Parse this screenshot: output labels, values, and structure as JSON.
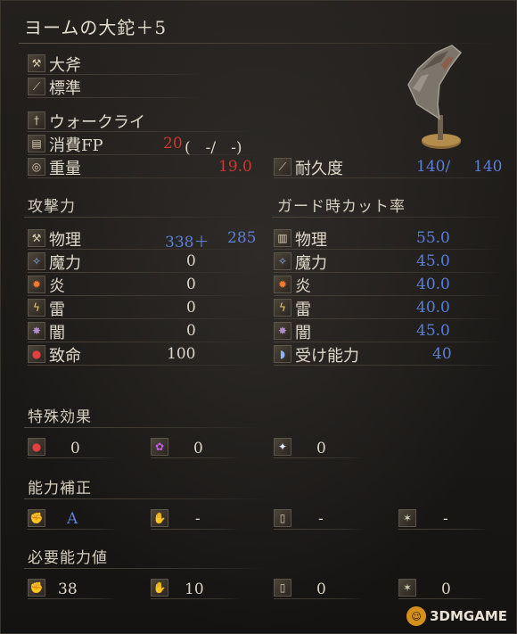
{
  "title": "ヨームの大鉈＋5",
  "weapon": {
    "type": "大斧",
    "attack_type": "標準",
    "skill": "ウォークライ",
    "fp_label": "消費FP",
    "fp_value": "20",
    "fp_extra": "(　-/　-)",
    "weight_label": "重量",
    "weight_value": "19.0",
    "durability_label": "耐久度",
    "durability_current": "140/",
    "durability_max": "140"
  },
  "attack": {
    "heading": "攻撃力",
    "rows": [
      {
        "label": "物理",
        "value": "338＋",
        "value2": "285",
        "icon": "physical-icon"
      },
      {
        "label": "魔力",
        "value": "0",
        "icon": "magic-icon"
      },
      {
        "label": "炎",
        "value": "0",
        "icon": "fire-icon"
      },
      {
        "label": "雷",
        "value": "0",
        "icon": "lightning-icon"
      },
      {
        "label": "闇",
        "value": "0",
        "icon": "dark-icon"
      },
      {
        "label": "致命",
        "value": "100",
        "icon": "critical-icon"
      }
    ]
  },
  "guard": {
    "heading": "ガード時カット率",
    "rows": [
      {
        "label": "物理",
        "value": "55.0",
        "icon": "physical-guard-icon"
      },
      {
        "label": "魔力",
        "value": "45.0",
        "icon": "magic-guard-icon"
      },
      {
        "label": "炎",
        "value": "40.0",
        "icon": "fire-guard-icon"
      },
      {
        "label": "雷",
        "value": "40.0",
        "icon": "lightning-guard-icon"
      },
      {
        "label": "闇",
        "value": "45.0",
        "icon": "dark-guard-icon"
      },
      {
        "label": "受け能力",
        "value": "40",
        "icon": "stability-icon"
      }
    ]
  },
  "special": {
    "heading": "特殊効果",
    "items": [
      {
        "value": "0",
        "icon": "bleed-icon"
      },
      {
        "value": "0",
        "icon": "poison-icon"
      },
      {
        "value": "0",
        "icon": "frost-icon"
      }
    ]
  },
  "scaling": {
    "heading": "能力補正",
    "items": [
      {
        "value": "A",
        "icon": "strength-icon"
      },
      {
        "value": "-",
        "icon": "dexterity-icon"
      },
      {
        "value": "-",
        "icon": "intelligence-icon"
      },
      {
        "value": "-",
        "icon": "faith-icon"
      }
    ]
  },
  "requirements": {
    "heading": "必要能力値",
    "items": [
      {
        "value": "38",
        "icon": "strength-req-icon"
      },
      {
        "value": "10",
        "icon": "dexterity-req-icon"
      },
      {
        "value": "0",
        "icon": "intelligence-req-icon"
      },
      {
        "value": "0",
        "icon": "faith-req-icon"
      }
    ]
  },
  "watermark": "3DMGAME"
}
